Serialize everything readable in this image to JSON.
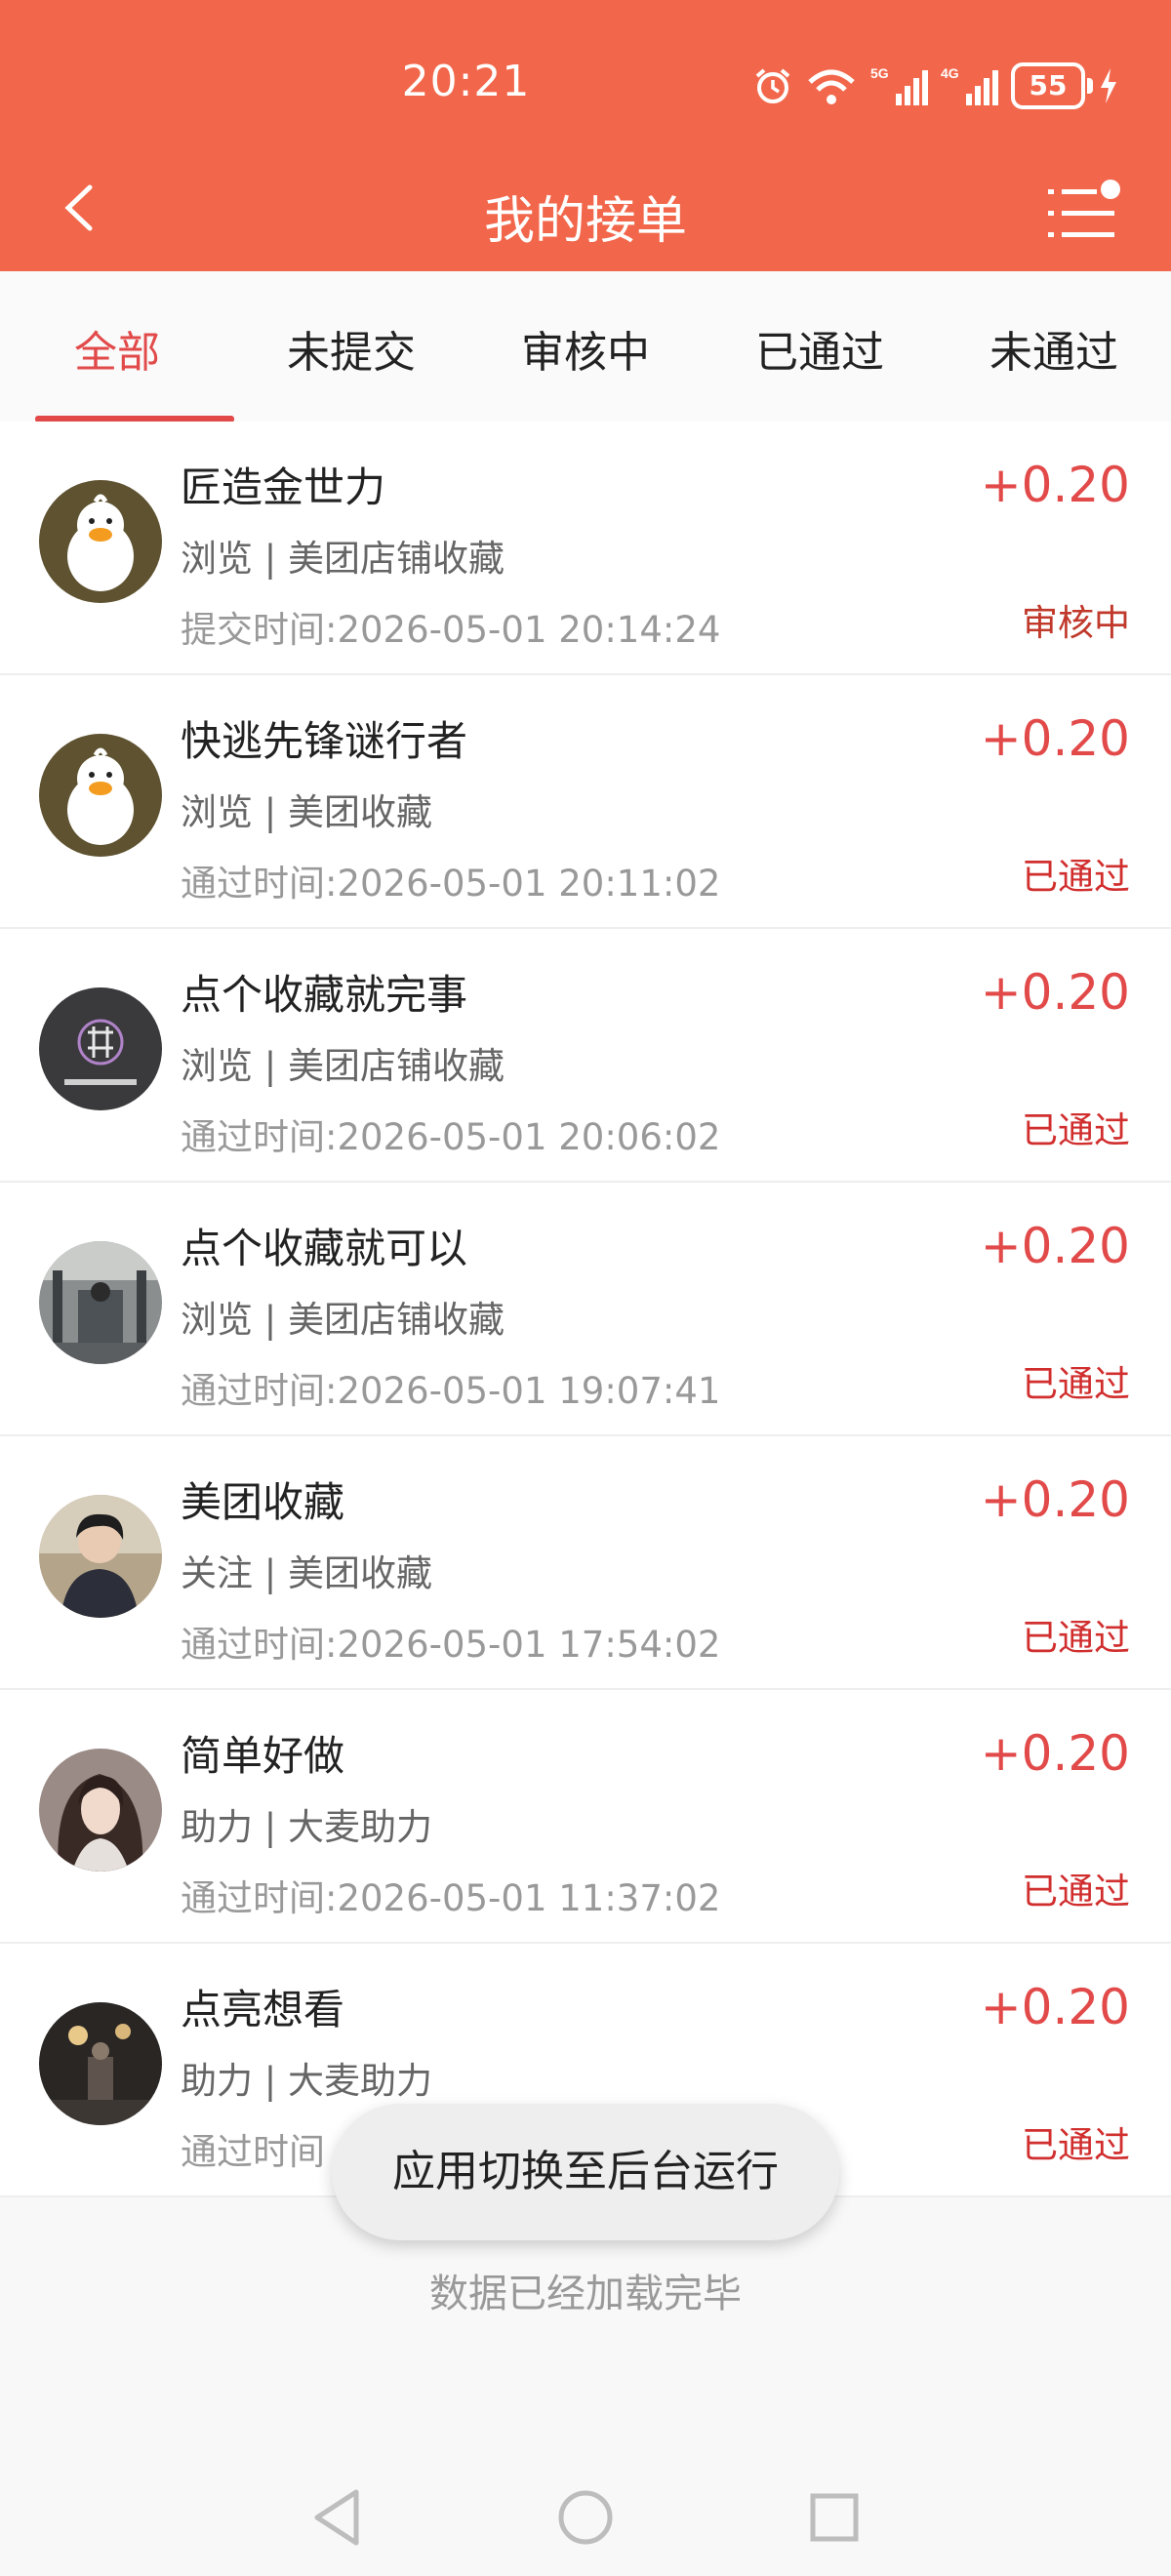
{
  "status_bar": {
    "time": "20:21",
    "battery": "55"
  },
  "header": {
    "title": "我的接单",
    "back_icon": "chevron-left-icon",
    "menu_icon": "list-menu-icon"
  },
  "tabs": [
    "全部",
    "未提交",
    "审核中",
    "已通过",
    "未通过"
  ],
  "items": [
    {
      "title": "匠造金世力",
      "sub": "浏览 | 美团店铺收藏",
      "time": "提交时间:2026-05-01 20:14:24",
      "amount": "+0.20",
      "status": "审核中"
    },
    {
      "title": "快逃先锋谜行者",
      "sub": "浏览 | 美团收藏",
      "time": "通过时间:2026-05-01 20:11:02",
      "amount": "+0.20",
      "status": "已通过"
    },
    {
      "title": "点个收藏就完事",
      "sub": "浏览 | 美团店铺收藏",
      "time": "通过时间:2026-05-01 20:06:02",
      "amount": "+0.20",
      "status": "已通过"
    },
    {
      "title": "点个收藏就可以",
      "sub": "浏览 | 美团店铺收藏",
      "time": "通过时间:2026-05-01 19:07:41",
      "amount": "+0.20",
      "status": "已通过"
    },
    {
      "title": "美团收藏",
      "sub": "关注 | 美团收藏",
      "time": "通过时间:2026-05-01 17:54:02",
      "amount": "+0.20",
      "status": "已通过"
    },
    {
      "title": "简单好做",
      "sub": "助力 | 大麦助力",
      "time": "通过时间:2026-05-01 11:37:02",
      "amount": "+0.20",
      "status": "已通过"
    },
    {
      "title": "点亮想看",
      "sub": "助力 | 大麦助力",
      "time": "通过时间",
      "amount": "+0.20",
      "status": "已通过"
    }
  ],
  "toast": "应用切换至后台运行",
  "footer": "数据已经加载完毕",
  "colors": {
    "header": "#f2674b",
    "accent": "#e24a4a"
  }
}
